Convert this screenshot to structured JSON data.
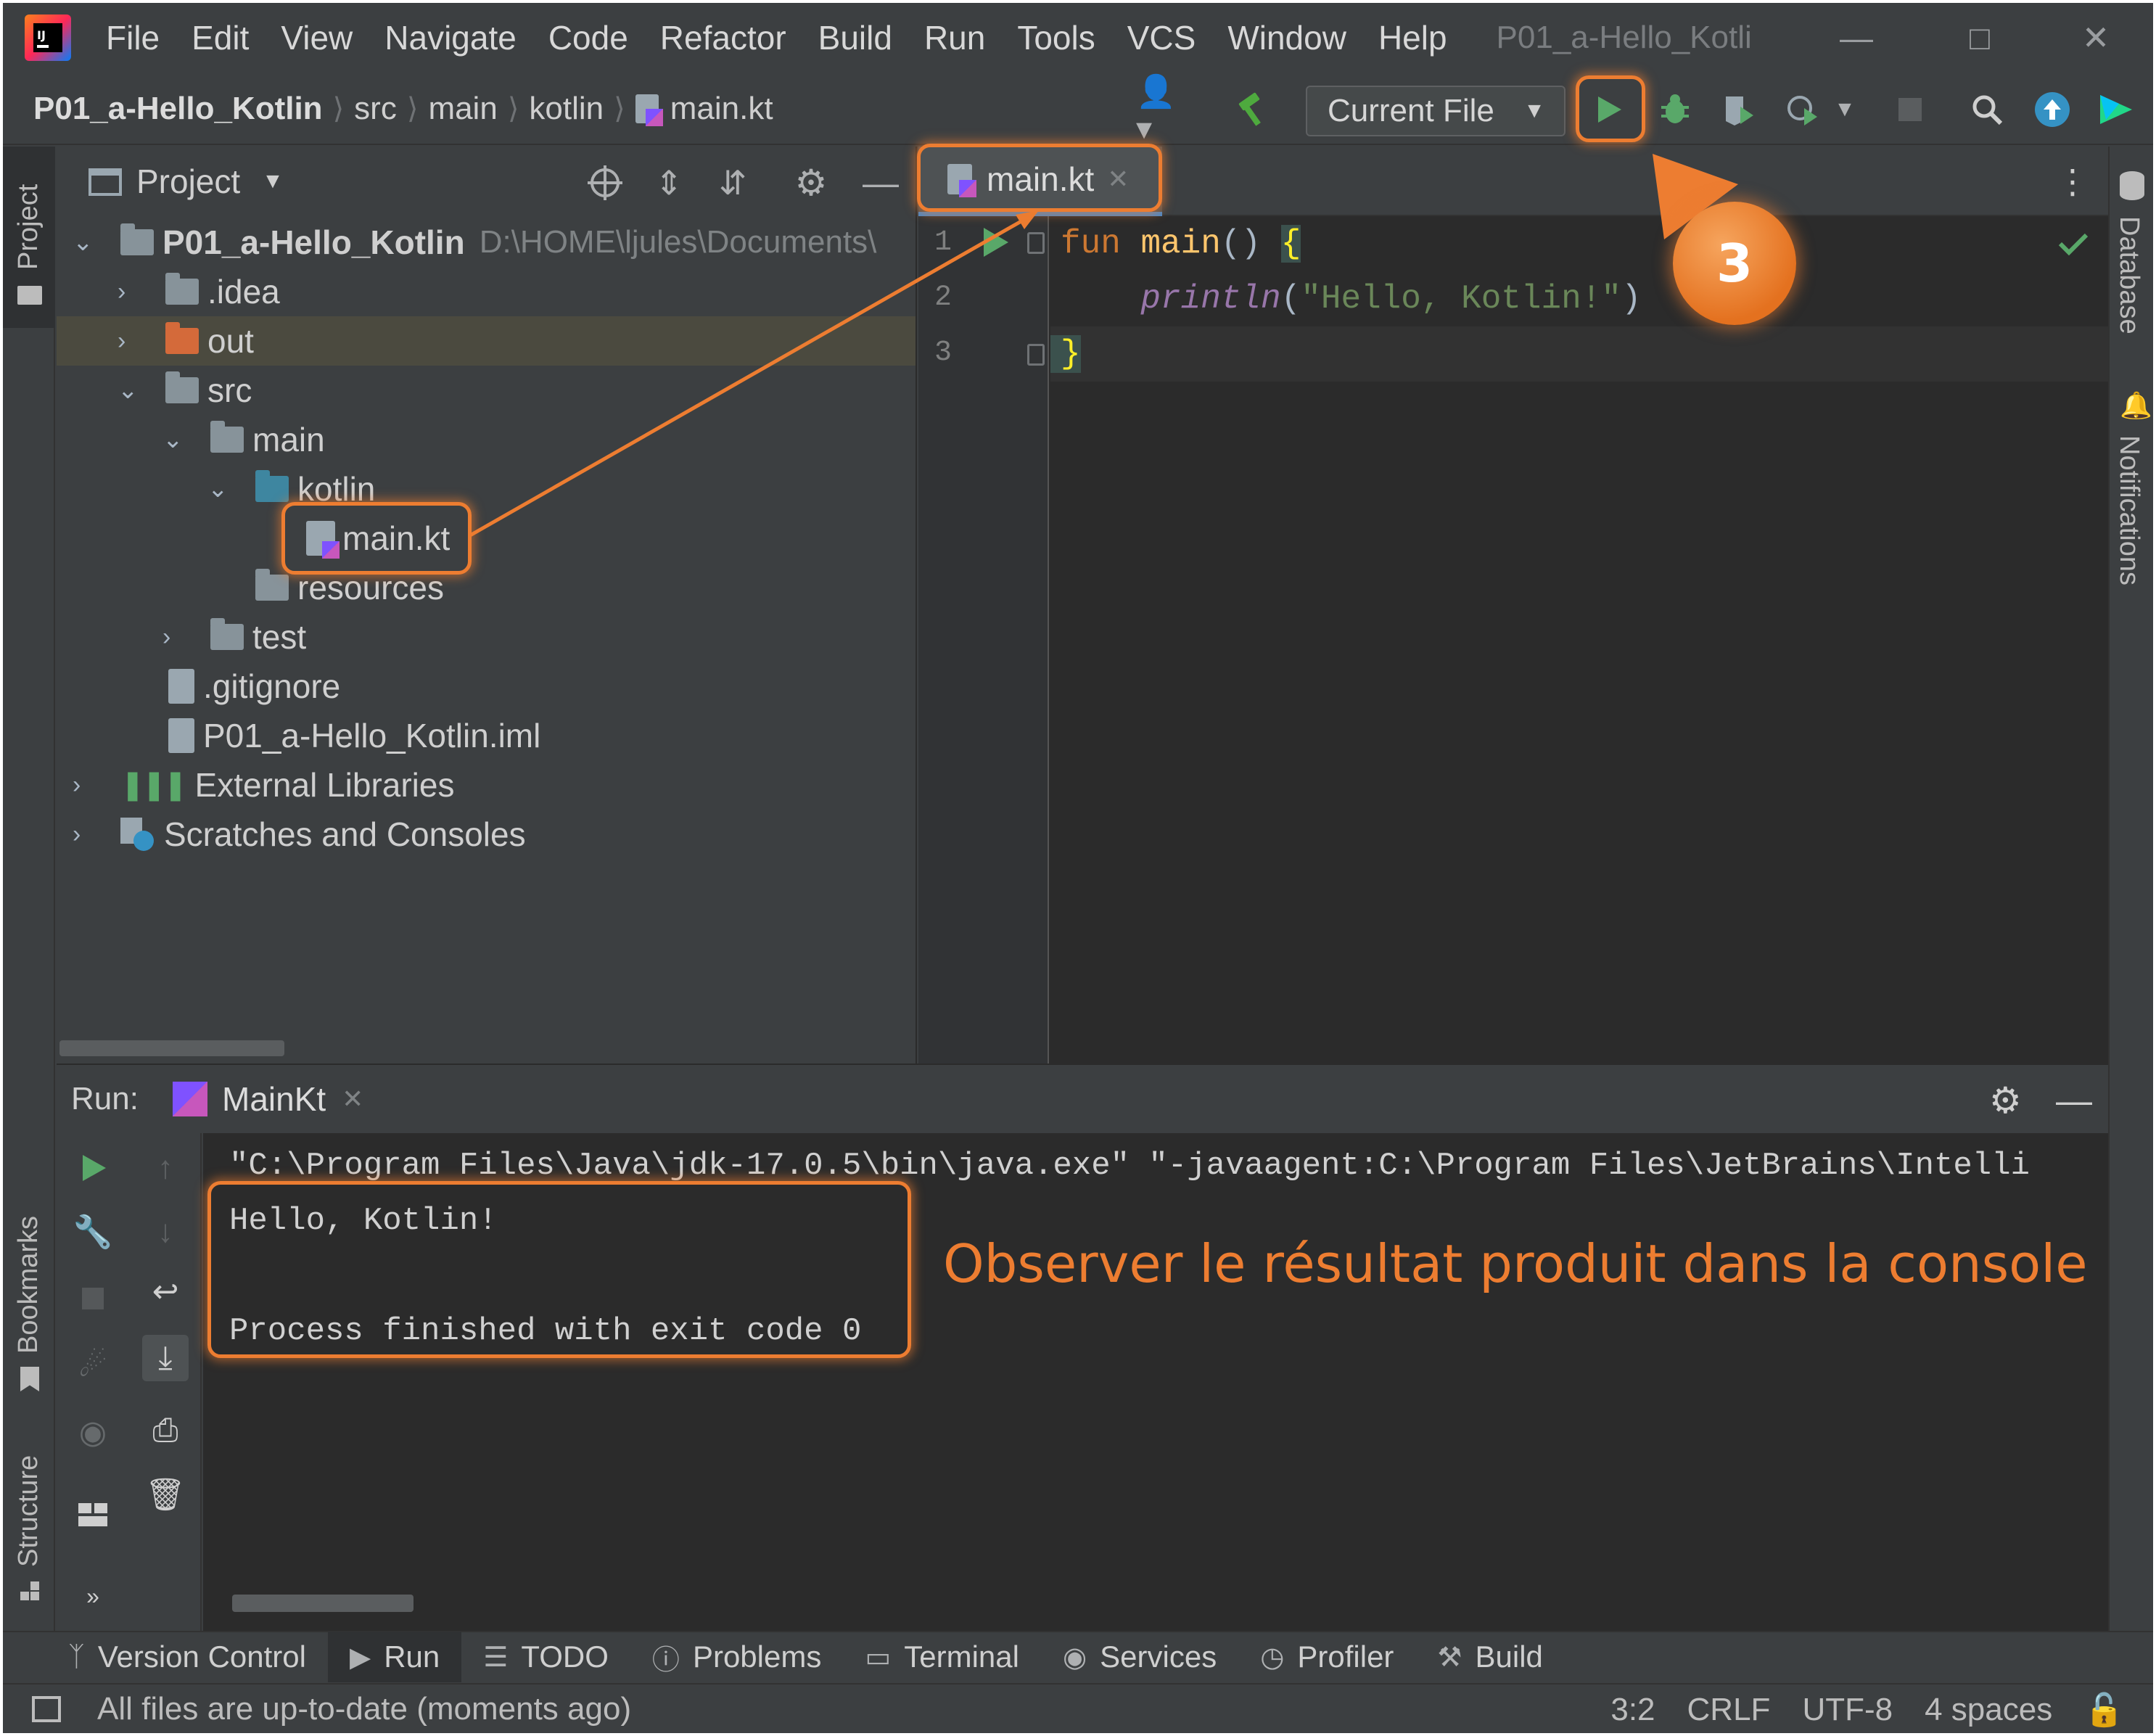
{
  "app": {
    "menu": [
      "File",
      "Edit",
      "View",
      "Navigate",
      "Code",
      "Refactor",
      "Build",
      "Run",
      "Tools",
      "VCS",
      "Window",
      "Help"
    ],
    "window_title": "P01_a-Hello_Kotli"
  },
  "breadcrumb": {
    "project": "P01_a-Hello_Kotlin",
    "parts": [
      "src",
      "main",
      "kotlin"
    ],
    "file": "main.kt"
  },
  "toolbar": {
    "run_config": "Current File",
    "icons": [
      "user-icon",
      "build-hammer-icon",
      "run-icon",
      "debug-icon",
      "coverage-icon",
      "profile-icon",
      "stop-icon",
      "search-icon",
      "update-icon",
      "toolbox-icon"
    ]
  },
  "left_stripe": {
    "project": "Project",
    "bookmarks": "Bookmarks",
    "structure": "Structure"
  },
  "right_stripe": {
    "database": "Database",
    "notifications": "Notifications"
  },
  "project_panel": {
    "title": "Project",
    "tree": [
      {
        "label": "P01_a-Hello_Kotlin",
        "path": "D:\\HOME\\ljules\\Documents\\",
        "kind": "project",
        "expanded": true
      },
      {
        "label": ".idea",
        "kind": "folder",
        "expanded": false
      },
      {
        "label": "out",
        "kind": "folder-excluded",
        "expanded": false
      },
      {
        "label": "src",
        "kind": "folder",
        "expanded": true
      },
      {
        "label": "main",
        "kind": "folder",
        "expanded": true
      },
      {
        "label": "kotlin",
        "kind": "folder-source",
        "expanded": true
      },
      {
        "label": "main.kt",
        "kind": "kotlin-file"
      },
      {
        "label": "resources",
        "kind": "folder-resources"
      },
      {
        "label": "test",
        "kind": "folder",
        "expanded": false
      },
      {
        "label": ".gitignore",
        "kind": "file"
      },
      {
        "label": "P01_a-Hello_Kotlin.iml",
        "kind": "file"
      },
      {
        "label": "External Libraries",
        "kind": "libraries",
        "expanded": false
      },
      {
        "label": "Scratches and Consoles",
        "kind": "scratches",
        "expanded": false
      }
    ]
  },
  "editor": {
    "tab": "main.kt",
    "line_numbers": [
      "1",
      "2",
      "3"
    ],
    "code": {
      "kw_fun": "fun",
      "fn_main": "main",
      "parens": "() ",
      "open_brace": "{",
      "println": "println",
      "open_paren": "(",
      "string": "\"Hello, Kotlin!\"",
      "close_paren": ")",
      "close_brace": "}"
    }
  },
  "run_panel": {
    "label": "Run:",
    "tab": "MainKt",
    "console": [
      "\"C:\\Program Files\\Java\\jdk-17.0.5\\bin\\java.exe\" \"-javaagent:C:\\Program Files\\JetBrains\\Intelli",
      "Hello, Kotlin!",
      "",
      "Process finished with exit code 0"
    ]
  },
  "bottom_bar": [
    "Version Control",
    "Run",
    "TODO",
    "Problems",
    "Terminal",
    "Services",
    "Profiler",
    "Build"
  ],
  "status": {
    "message": "All files are up-to-date (moments ago)",
    "position": "3:2",
    "line_sep": "CRLF",
    "encoding": "UTF-8",
    "indent": "4 spaces"
  },
  "annotation": {
    "step": "3",
    "text": "Observer le résultat produit dans la console",
    "color": "#ed7d31"
  }
}
